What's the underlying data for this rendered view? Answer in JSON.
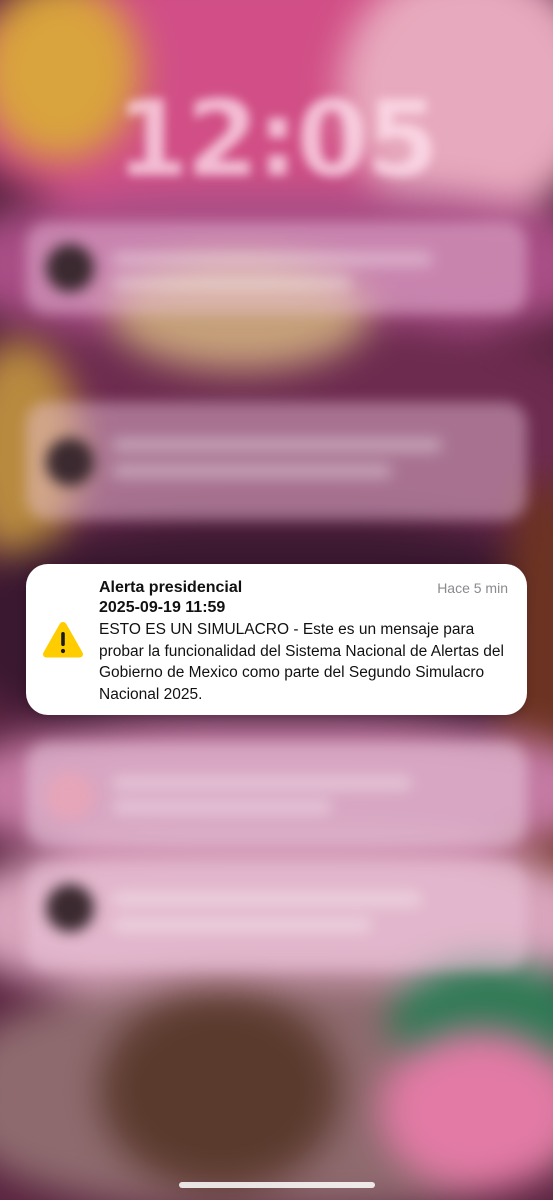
{
  "lock_screen": {
    "clock": "12:05"
  },
  "alert": {
    "title": "Alerta presidencial",
    "timestamp": "Hace 5 min",
    "date": "2025-09-19 11:59",
    "body": "ESTO ES UN SIMULACRO - Este es un mensaje para probar la funcionalidad del Sistema Nacional de Alertas del Gobierno de Mexico como parte del Segundo Simulacro Nacional 2025.",
    "icon": "warning-triangle-icon",
    "icon_color": "#FFCC00"
  }
}
